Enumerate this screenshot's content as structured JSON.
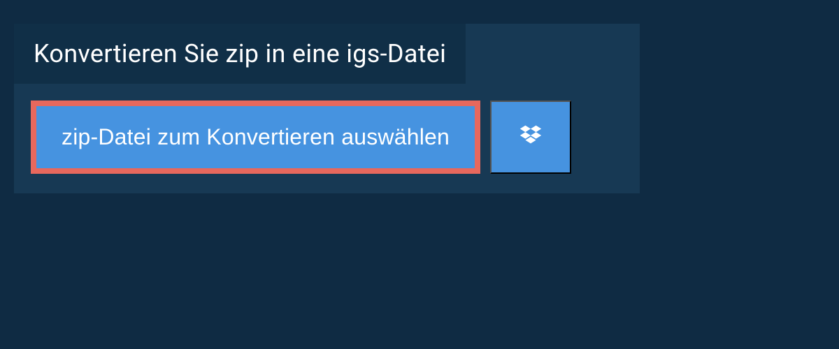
{
  "header": {
    "title": "Konvertieren Sie zip in eine igs-Datei"
  },
  "actions": {
    "select_file_label": "zip-Datei zum Konvertieren auswählen"
  },
  "colors": {
    "page_bg": "#0f2b43",
    "panel_bg": "#173954",
    "header_bg": "#102f47",
    "button_bg": "#4693e0",
    "button_border": "#e7685d"
  }
}
